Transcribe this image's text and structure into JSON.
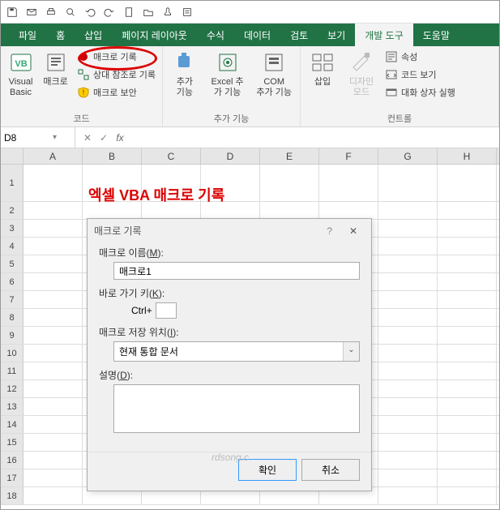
{
  "qat": {},
  "tabs": {
    "file": "파일",
    "home": "홈",
    "insert": "삽입",
    "pagelayout": "페이지 레이아웃",
    "formulas": "수식",
    "data": "데이터",
    "review": "검토",
    "view": "보기",
    "developer": "개발 도구",
    "help": "도움말"
  },
  "ribbon": {
    "code": {
      "visualbasic": "Visual\nBasic",
      "macros": "매크로",
      "record": "매크로 기록",
      "relative": "상대 참조로 기록",
      "security": "매크로 보안",
      "group": "코드"
    },
    "addins": {
      "addin": "추가\n기능",
      "excel_addin": "Excel 추\n가 기능",
      "com_addin": "COM\n추가 기능",
      "group": "추가 기능"
    },
    "controls": {
      "insert": "삽입",
      "design": "디자인\n모드",
      "properties": "속성",
      "viewcode": "코드 보기",
      "rundialog": "대화 상자 실행",
      "group": "컨트롤"
    }
  },
  "namebox": {
    "value": "D8"
  },
  "columns": [
    "A",
    "B",
    "C",
    "D",
    "E",
    "F",
    "G",
    "H"
  ],
  "rows": [
    "1",
    "2",
    "3",
    "4",
    "5",
    "6",
    "7",
    "8",
    "9",
    "10",
    "11",
    "12",
    "13",
    "14",
    "15",
    "16",
    "17",
    "18"
  ],
  "banner": "엑셀 VBA 매크로 기록",
  "dialog": {
    "title": "매크로 기록",
    "name_label_pre": "매크로 이름(",
    "name_label_u": "M",
    "name_label_post": "):",
    "name_value": "매크로1",
    "shortcut_label_pre": "바로 가기 키(",
    "shortcut_label_u": "K",
    "shortcut_label_post": "):",
    "ctrl_label": "Ctrl+",
    "store_label_pre": "매크로 저장 위치(",
    "store_label_u": "I",
    "store_label_post": "):",
    "store_value": "현재 통합 문서",
    "desc_label_pre": "설명(",
    "desc_label_u": "D",
    "desc_label_post": "):",
    "ok": "확인",
    "cancel": "취소"
  },
  "watermark": "rdsong.c"
}
